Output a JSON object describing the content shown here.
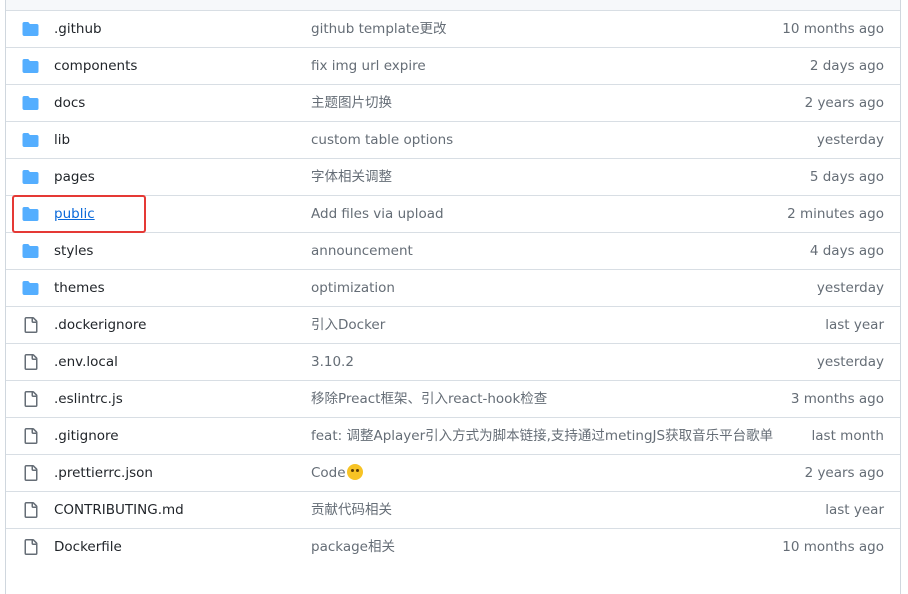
{
  "files": [
    {
      "name": ".github",
      "type": "folder",
      "message": "github template更改",
      "age": "10 months ago"
    },
    {
      "name": "components",
      "type": "folder",
      "message": "fix img url expire",
      "age": "2 days ago"
    },
    {
      "name": "docs",
      "type": "folder",
      "message": "主题图片切换",
      "age": "2 years ago"
    },
    {
      "name": "lib",
      "type": "folder",
      "message": "custom table options",
      "age": "yesterday"
    },
    {
      "name": "pages",
      "type": "folder",
      "message": "字体相关调整",
      "age": "5 days ago"
    },
    {
      "name": "public",
      "type": "folder",
      "message": "Add files via upload",
      "age": "2 minutes ago"
    },
    {
      "name": "styles",
      "type": "folder",
      "message": "announcement",
      "age": "4 days ago"
    },
    {
      "name": "themes",
      "type": "folder",
      "message": "optimization",
      "age": "yesterday"
    },
    {
      "name": ".dockerignore",
      "type": "file",
      "message": "引入Docker",
      "age": "last year"
    },
    {
      "name": ".env.local",
      "type": "file",
      "message": "3.10.2",
      "age": "yesterday"
    },
    {
      "name": ".eslintrc.js",
      "type": "file",
      "message": "移除Preact框架、引入react-hook检查",
      "age": "3 months ago"
    },
    {
      "name": ".gitignore",
      "type": "file",
      "message": "feat: 调整Aplayer引入方式为脚本链接,支持通过metingJS获取音乐平台歌单",
      "age": "last month"
    },
    {
      "name": ".prettierrc.json",
      "type": "file",
      "message": "Code",
      "age": "2 years ago"
    },
    {
      "name": "CONTRIBUTING.md",
      "type": "file",
      "message": "贡献代码相关",
      "age": "last year"
    },
    {
      "name": "Dockerfile",
      "type": "file",
      "message": "package相关",
      "age": "10 months ago"
    }
  ],
  "colors": {
    "folder": "#54aeff",
    "link": "#0969da",
    "highlight": "#e53935"
  }
}
